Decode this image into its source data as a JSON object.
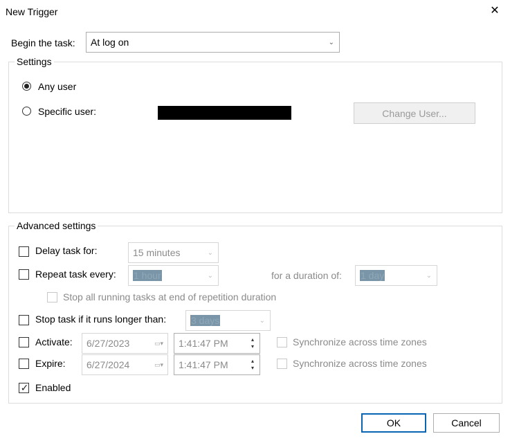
{
  "window": {
    "title": "New Trigger"
  },
  "begin": {
    "label": "Begin the task:",
    "value": "At log on"
  },
  "settings": {
    "legend": "Settings",
    "any_user": "Any user",
    "specific_user": "Specific user:",
    "change_user": "Change User..."
  },
  "advanced": {
    "legend": "Advanced settings",
    "delay_label": "Delay task for:",
    "delay_value": "15 minutes",
    "repeat_label": "Repeat task every:",
    "repeat_value": "1 hour",
    "duration_label": "for a duration of:",
    "duration_value": "1 day",
    "stop_running": "Stop all running tasks at end of repetition duration",
    "stop_longer_label": "Stop task if it runs longer than:",
    "stop_longer_value": "3 days",
    "activate_label": "Activate:",
    "activate_date": "6/27/2023",
    "activate_time": "1:41:47 PM",
    "activate_sync": "Synchronize across time zones",
    "expire_label": "Expire:",
    "expire_date": "6/27/2024",
    "expire_time": "1:41:47 PM",
    "expire_sync": "Synchronize across time zones",
    "enabled_label": "Enabled"
  },
  "buttons": {
    "ok": "OK",
    "cancel": "Cancel"
  },
  "icons": {
    "close": "close-icon",
    "chevron": "chevron-down-icon",
    "calendar": "calendar-icon",
    "spinner": "spinner-icon",
    "check": "checkmark-icon"
  },
  "colors": {
    "accent": "#0a64b4",
    "highlight": "#7a95a8"
  }
}
